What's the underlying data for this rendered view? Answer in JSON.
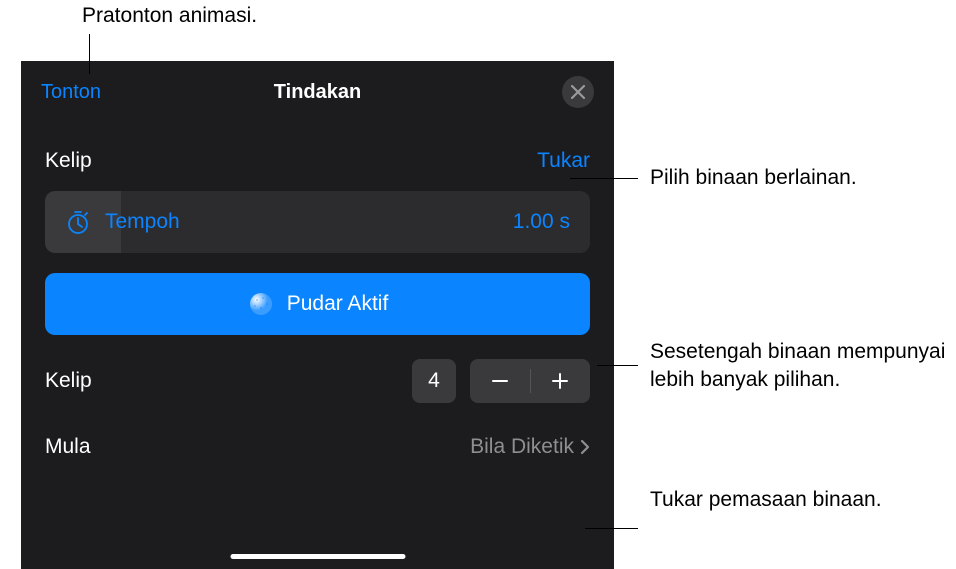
{
  "header": {
    "watch_label": "Tonton",
    "title": "Tindakan"
  },
  "section": {
    "name": "Kelip",
    "change_label": "Tukar"
  },
  "duration": {
    "label": "Tempoh",
    "value": "1.00 s"
  },
  "effect_button": {
    "label": "Pudar Aktif"
  },
  "kelip_count": {
    "label": "Kelip",
    "value": "4"
  },
  "start": {
    "label": "Mula",
    "value": "Bila Diketik"
  },
  "callouts": {
    "c1": "Pratonton animasi.",
    "c2": "Pilih binaan berlainan.",
    "c3": "Sesetengah binaan mempunyai lebih banyak pilihan.",
    "c4": "Tukar pemasaan binaan."
  }
}
